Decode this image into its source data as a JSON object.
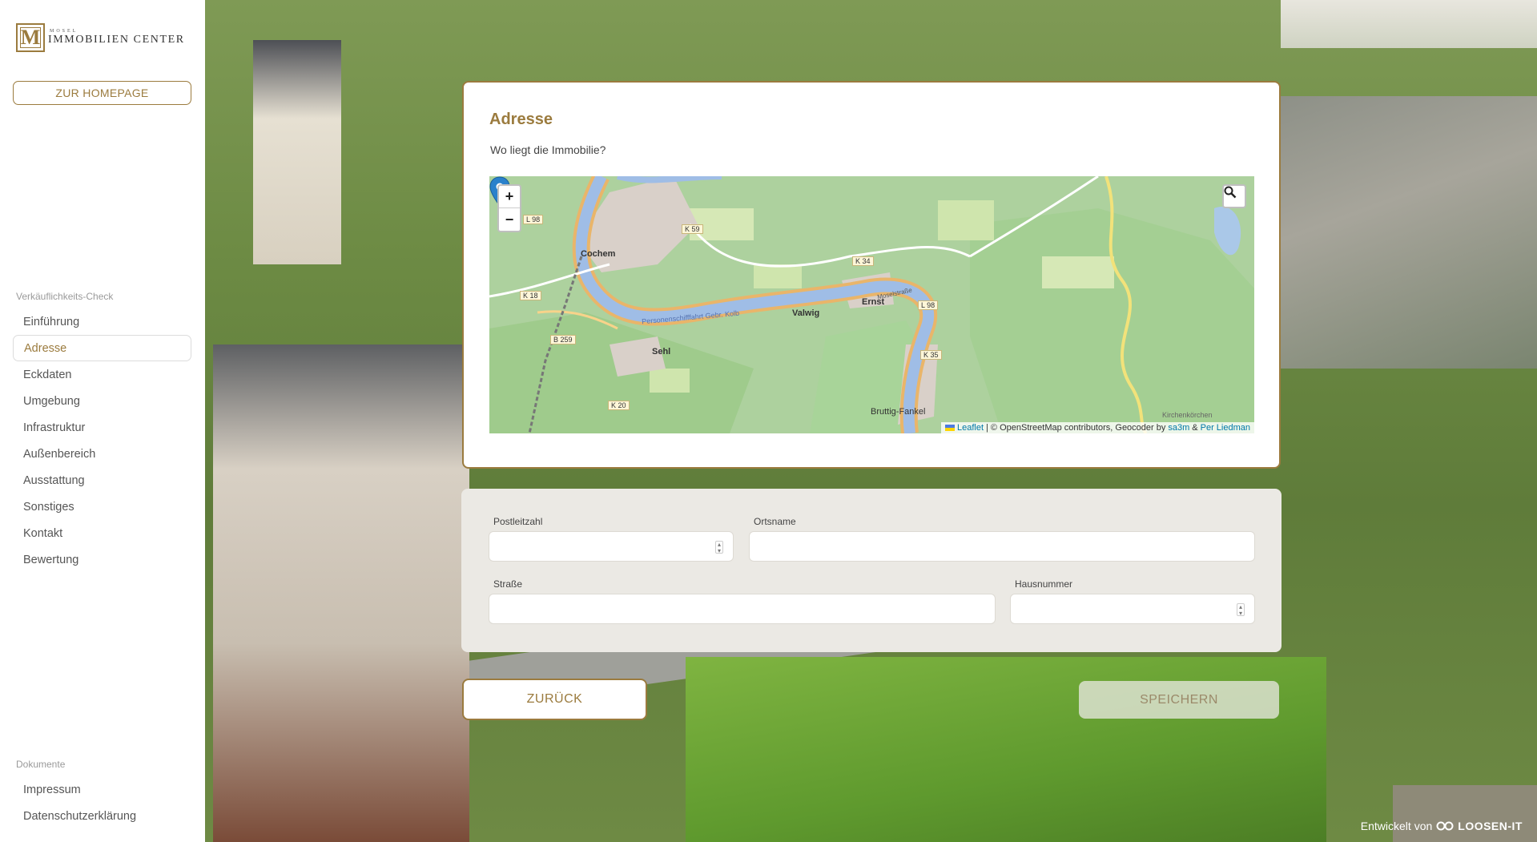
{
  "sidebar": {
    "logo": {
      "small": "MOSEL",
      "big": "IMMOBILIEN CENTER",
      "mark": "M"
    },
    "home_button": "ZUR HOMEPAGE",
    "check_label": "Verkäuflichkeits-Check",
    "check_items": [
      {
        "label": "Einführung"
      },
      {
        "label": "Adresse"
      },
      {
        "label": "Eckdaten"
      },
      {
        "label": "Umgebung"
      },
      {
        "label": "Infrastruktur"
      },
      {
        "label": "Außenbereich"
      },
      {
        "label": "Ausstattung"
      },
      {
        "label": "Sonstiges"
      },
      {
        "label": "Kontakt"
      },
      {
        "label": "Bewertung"
      }
    ],
    "docs_label": "Dokumente",
    "doc_items": [
      {
        "label": "Impressum"
      },
      {
        "label": "Datenschutzerklärung"
      }
    ]
  },
  "card": {
    "title": "Adresse",
    "question": "Wo liegt die Immobilie?"
  },
  "map": {
    "zoom_in": "+",
    "zoom_out": "−",
    "places": {
      "cochem": "Cochem",
      "sehl": "Sehl",
      "valwig": "Valwig",
      "ernst": "Ernst",
      "bruttig": "Bruttig-Fankel",
      "kirchen": "Kirchenkörchen"
    },
    "roads": {
      "l98a": "L 98",
      "l98b": "L 98",
      "k59": "K 59",
      "k34": "K 34",
      "k18": "K 18",
      "b259": "B 259",
      "k35": "K 35",
      "k20": "K 20"
    },
    "river_label": "Personenschifffahrt Gebr. Kolb",
    "street_label": "Moselstraße",
    "attribution": {
      "leaflet": "Leaflet",
      "text": "| © OpenStreetMap contributors, Geocoder by",
      "sa3m": "sa3m",
      "amp": "&",
      "per": "Per Liedman"
    }
  },
  "form": {
    "plz_label": "Postleitzahl",
    "plz_value": "",
    "ort_label": "Ortsname",
    "ort_value": "",
    "strasse_label": "Straße",
    "strasse_value": "",
    "hausnummer_label": "Hausnummer",
    "hausnummer_value": ""
  },
  "buttons": {
    "back": "ZURÜCK",
    "save": "SPEICHERN"
  },
  "footer": {
    "prefix": "Entwickelt von",
    "brand": "LOOSEN-IT"
  },
  "colors": {
    "accent": "#9b7b3e",
    "form_bg": "#ebe9e4",
    "link": "#0078a8"
  }
}
